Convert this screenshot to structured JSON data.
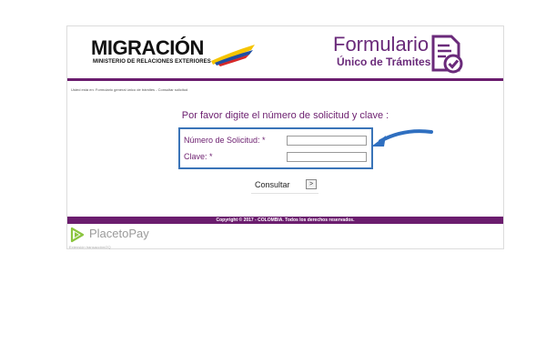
{
  "header": {
    "migracion_title": "MIGRACIÓN",
    "migracion_subtitle": "MINISTERIO DE RELACIONES EXTERIORES",
    "formulario_title": "Formulario",
    "formulario_subtitle": "Único de Trámites"
  },
  "breadcrumb": {
    "text": "Usted está en: Formulario general único de trámites - Consultar solicitud"
  },
  "form": {
    "prompt": "Por favor digite el número de solicitud y clave :",
    "solicitud_label": "Número de Solicitud: *",
    "solicitud_value": "",
    "clave_label": "Clave: *",
    "clave_value": "",
    "submit_label": "Consultar",
    "submit_button_glyph": ">"
  },
  "footer": {
    "copyright": "Copyright © 2017 - COLOMBIA. Todos los derechos reservados."
  },
  "placetopay": {
    "brand": "PlacetoPay",
    "subtext": "Extensión transacción/2Q"
  },
  "colors": {
    "brand_purple": "#6b1d6e",
    "box_border_blue": "#3a74b8",
    "arrow_blue": "#2f6fc0",
    "ptp_green": "#8bc53f"
  },
  "icons": {
    "form_document": "document-check-icon",
    "arrow": "curved-arrow-icon",
    "placetopay": "play-triangle-icon"
  }
}
